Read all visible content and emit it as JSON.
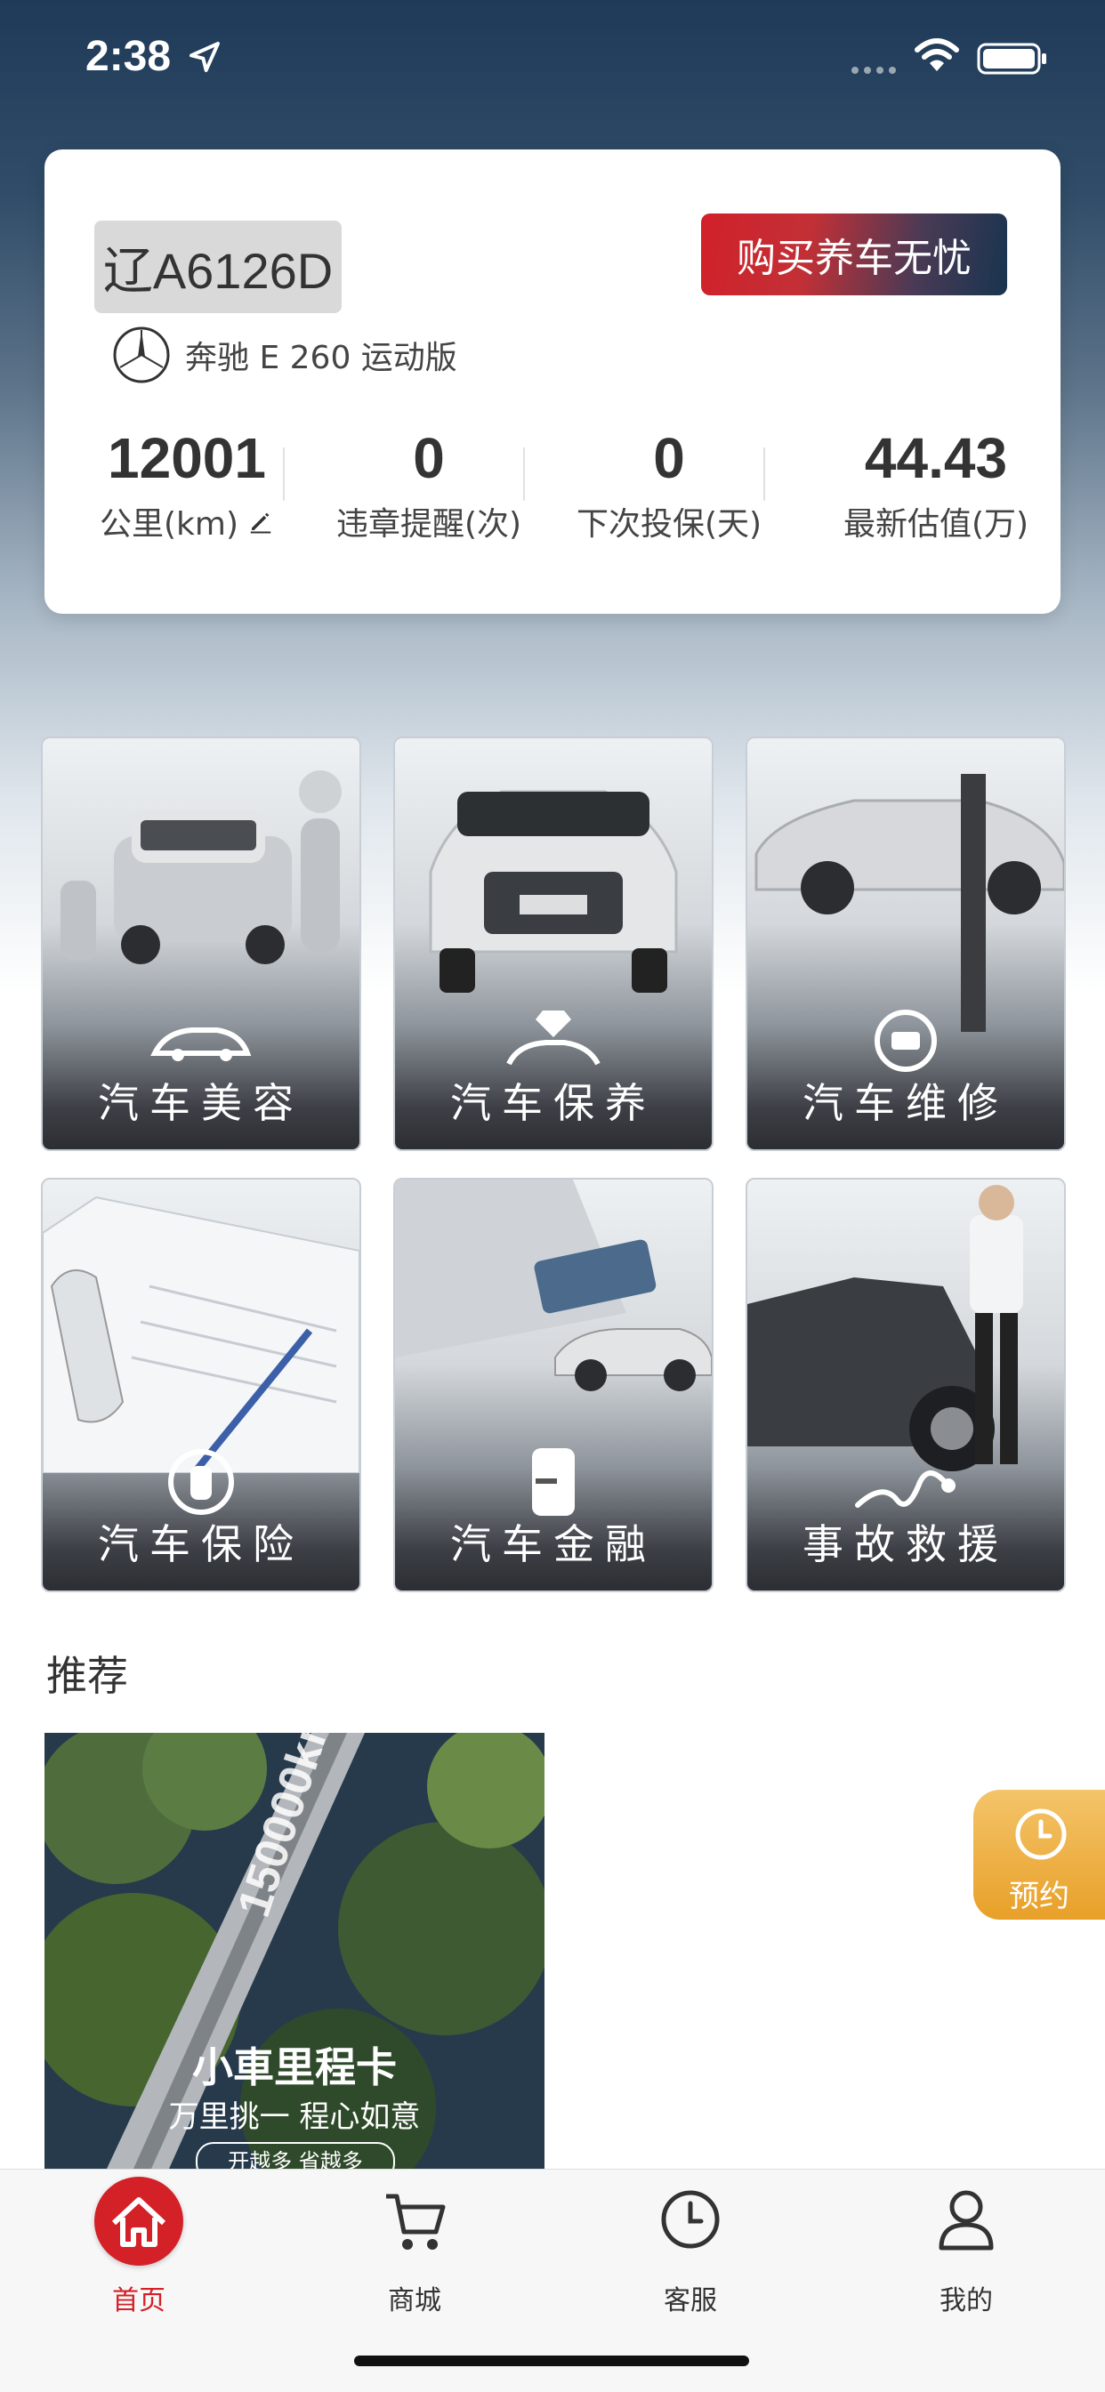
{
  "status_bar": {
    "time": "2:38"
  },
  "car": {
    "plate": "辽A6126D",
    "buy_button": "购买养车无忧",
    "model": "奔驰 E 260 运动版",
    "stats": [
      {
        "value": "12001",
        "label": "公里(km)"
      },
      {
        "value": "0",
        "label": "违章提醒(次)"
      },
      {
        "value": "0",
        "label": "下次投保(天)"
      },
      {
        "value": "44.43",
        "label": "最新估值(万)"
      }
    ]
  },
  "services": [
    {
      "label": "汽车美容",
      "icon": "car-wrench-icon"
    },
    {
      "label": "汽车保养",
      "icon": "car-diamond-icon"
    },
    {
      "label": "汽车维修",
      "icon": "repair-icon"
    },
    {
      "label": "汽车保险",
      "icon": "car-shield-icon"
    },
    {
      "label": "汽车金融",
      "icon": "card-icon"
    },
    {
      "label": "事故救援",
      "icon": "tow-rope-icon"
    }
  ],
  "recommend": {
    "title": "推荐",
    "banner_title": "小車里程卡",
    "banner_sub": "万里挑一 程心如意",
    "banner_tag": "开越多 省越多",
    "banner_road_text": "150000km"
  },
  "floating": {
    "book_label": "预约"
  },
  "tabbar": {
    "tabs": [
      {
        "label": "首页",
        "icon": "home-icon",
        "active": true
      },
      {
        "label": "商城",
        "icon": "cart-icon",
        "active": false
      },
      {
        "label": "客服",
        "icon": "clock-icon",
        "active": false
      },
      {
        "label": "我的",
        "icon": "user-icon",
        "active": false
      }
    ]
  },
  "colors": {
    "accent": "#d42027",
    "book_orange": "#eca63a"
  }
}
